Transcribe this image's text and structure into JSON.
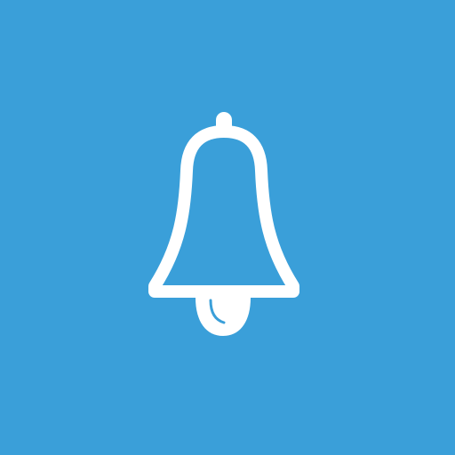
{
  "app_icon": {
    "icon": "bell-icon",
    "background_color": "#3A9FD9",
    "icon_color": "#FFFFFF"
  }
}
